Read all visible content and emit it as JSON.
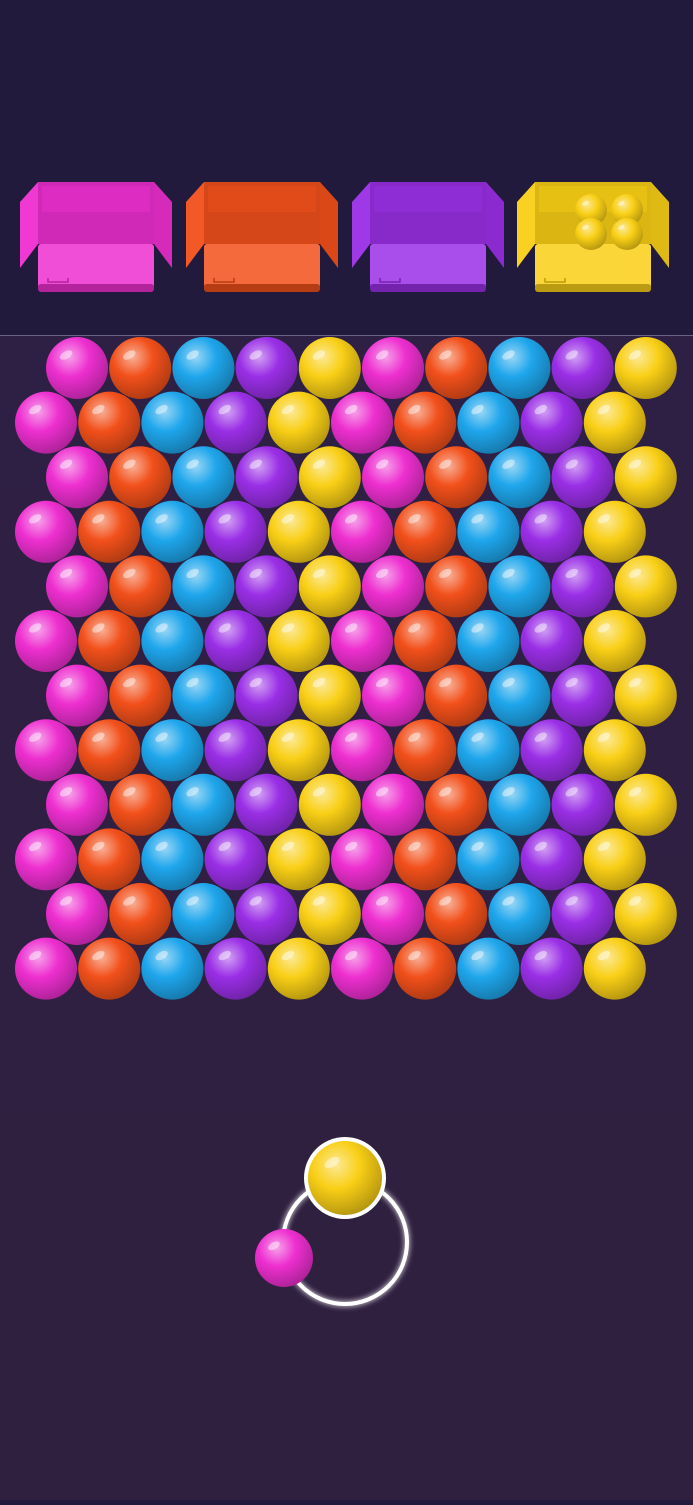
{
  "colors": {
    "pink": "#ee2fd0",
    "orange": "#f2501b",
    "blue": "#1fa6ec",
    "purple": "#9a2fe6",
    "yellow": "#f9cf16"
  },
  "boxes": [
    {
      "name": "pink-box",
      "color": "pink",
      "balls_inside": 0
    },
    {
      "name": "orange-box",
      "color": "orange",
      "balls_inside": 0
    },
    {
      "name": "purple-box",
      "color": "purple",
      "balls_inside": 0
    },
    {
      "name": "yellow-box",
      "color": "yellow",
      "balls_inside": 4
    }
  ],
  "grid": {
    "rows": 12,
    "columns": 10,
    "color_pattern": [
      "pink",
      "orange",
      "blue",
      "purple",
      "yellow",
      "pink",
      "orange",
      "blue",
      "purple",
      "yellow"
    ]
  },
  "shooter": {
    "current_ball": "yellow",
    "next_ball": "pink"
  }
}
